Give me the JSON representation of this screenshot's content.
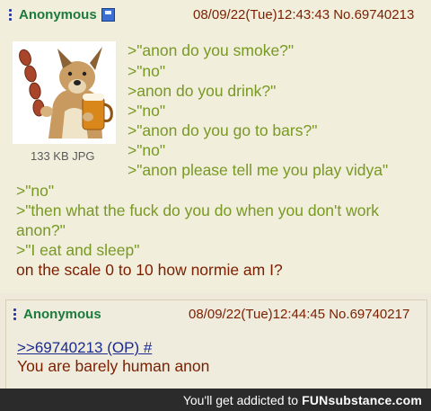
{
  "op": {
    "name": "Anonymous",
    "meta": "08/09/22(Tue)12:43:43 No.69740213",
    "file_info": "133 KB JPG",
    "lines": [
      ">\"anon do you smoke?\"",
      ">\"no\"",
      ">anon do you drink?\"",
      ">\"no\"",
      ">\"anon do you go to bars?\"",
      ">\"no\"",
      ">\"anon please tell me you play vidya\"",
      ">\"no\"",
      ">\"then what the fuck do you do when you don't work",
      "anon?\"",
      ">\"I eat and sleep\"",
      "on the scale 0 to 10 how normie am I?"
    ]
  },
  "reply": {
    "name": "Anonymous",
    "meta": "08/09/22(Tue)12:44:45 No.69740217",
    "quote_link": ">>69740213 (OP) #",
    "text": "You are barely human anon"
  },
  "footer": {
    "text": "You'll get addicted to",
    "brand": "FUNsubstance.com"
  },
  "colors": {
    "greentext": "#789922",
    "name": "#1c7a3c",
    "body": "#7a1f00",
    "link": "#1a2a8c"
  }
}
